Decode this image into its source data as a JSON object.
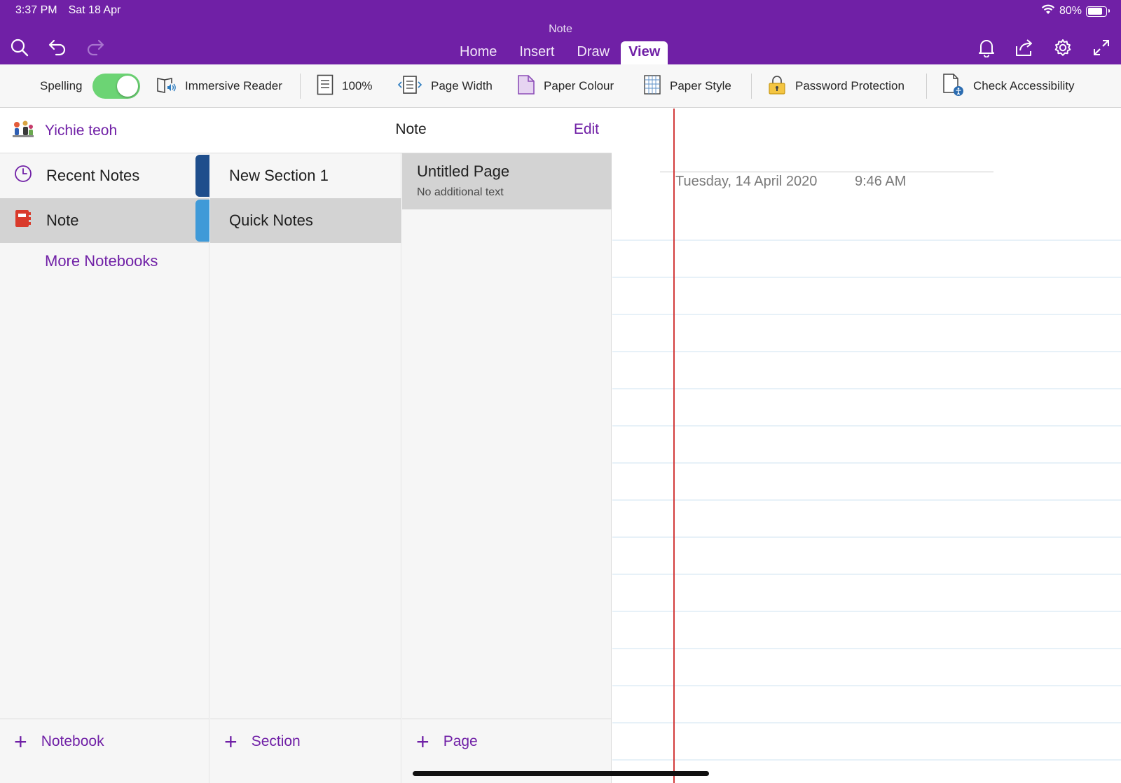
{
  "status_bar": {
    "time": "3:37 PM",
    "date": "Sat 18 Apr",
    "battery": "80%",
    "battery_level": 0.8
  },
  "app": {
    "title": "Note"
  },
  "header": {
    "tabs": [
      {
        "label": "Home",
        "active": false
      },
      {
        "label": "Insert",
        "active": false
      },
      {
        "label": "Draw",
        "active": false
      },
      {
        "label": "View",
        "active": true
      }
    ],
    "icons": [
      "search-icon",
      "undo-icon",
      "redo-icon",
      "bell-icon",
      "share-icon",
      "gear-icon",
      "expand-icon"
    ]
  },
  "ribbon": {
    "spelling": {
      "label": "Spelling",
      "on": true
    },
    "immersive_reader": "Immersive Reader",
    "zoom": "100%",
    "page_width": "Page Width",
    "paper_colour": "Paper Colour",
    "paper_style": "Paper Style",
    "password_protection": "Password Protection",
    "check_accessibility": "Check Accessibility"
  },
  "notebooks_panel": {
    "user_name": "Yichie teoh",
    "items": [
      {
        "label": "Recent Notes",
        "icon": "clock-icon",
        "tab_color": "#1f4e8c",
        "selected": false
      },
      {
        "label": "Note",
        "icon": "notebook-icon",
        "tab_color": "#3f9ad8",
        "selected": true
      }
    ],
    "more_notebooks": "More Notebooks",
    "add_label": "Notebook"
  },
  "middle_header": {
    "title": "Note",
    "edit": "Edit"
  },
  "sections_panel": {
    "items": [
      {
        "label": "New Section 1",
        "selected": false
      },
      {
        "label": "Quick Notes",
        "selected": true
      }
    ],
    "add_label": "Section"
  },
  "pages_panel": {
    "items": [
      {
        "title": "Untitled Page",
        "subtitle": "No additional text"
      }
    ],
    "add_label": "Page"
  },
  "canvas": {
    "date": "Tuesday, 14 April 2020",
    "time": "9:46 AM"
  },
  "colors": {
    "brand": "#7020a6",
    "toggle_on": "#6cd474",
    "margin_line": "#d33c3c",
    "rule_line": "#cfe3f2"
  }
}
